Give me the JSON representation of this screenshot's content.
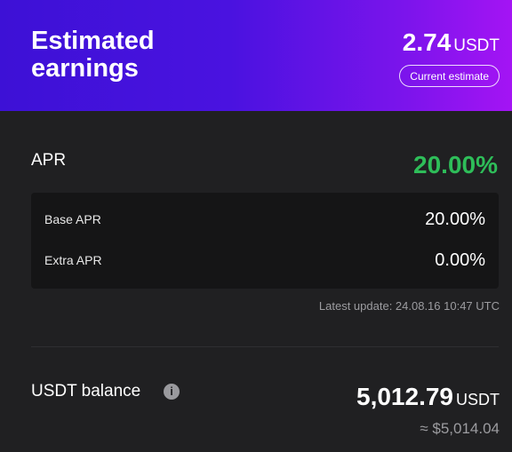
{
  "header": {
    "title": "Estimated\nearnings",
    "earnings_value": "2.74",
    "earnings_unit": "USDT",
    "estimate_button_label": "Current estimate"
  },
  "apr": {
    "label": "APR",
    "total": "20.00%",
    "rows": [
      {
        "label": "Base APR",
        "value": "20.00%"
      },
      {
        "label": "Extra APR",
        "value": "0.00%"
      }
    ],
    "latest_update": "Latest update: 24.08.16 10:47 UTC"
  },
  "balance": {
    "label": "USDT balance",
    "info_icon": "info-icon",
    "value": "5,012.79",
    "unit": "USDT",
    "approx": "≈ $5,014.04"
  },
  "colors": {
    "accent_green": "#2ebd59",
    "header_gradient_start": "#3d11d6",
    "header_gradient_end": "#a414f4",
    "background": "#202022"
  }
}
